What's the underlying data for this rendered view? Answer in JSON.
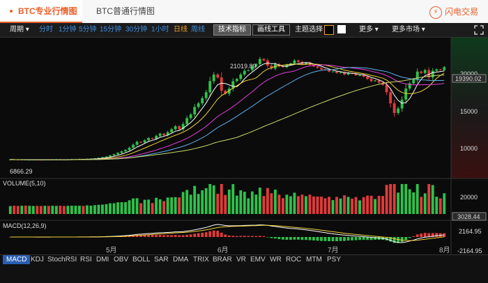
{
  "header": {
    "tab_active": "BTC专业行情图",
    "tab_normal": "BTC普通行情图",
    "brand": "闪电交易",
    "brand_icon": "lightning-icon"
  },
  "toolbar": {
    "period_menu": "周期",
    "periods": [
      "分时",
      "1分钟",
      "5分钟",
      "15分钟",
      "30分钟",
      "1小时",
      "日线",
      "周线"
    ],
    "selected_period": "日线",
    "tech_indicators": "技术指标",
    "draw_tools": "画线工具",
    "theme": "主题选择",
    "more": "更多",
    "more_markets": "更多市场"
  },
  "colors": {
    "up": "#2fc14b",
    "down": "#e23b3b",
    "ma1": "#ffffff",
    "ma2": "#f2d13a",
    "ma3": "#e83dde",
    "ma4": "#5fb0ee",
    "ma5": "#c5d968",
    "dif": "#ffffff",
    "dea": "#f2d13a"
  },
  "chart_data": {
    "type": "candlestick",
    "price_axis_ticks": [
      "20000",
      "15000",
      "10000"
    ],
    "price_ylim": [
      5000,
      21500
    ],
    "last_price": "19390.02",
    "max_label": "21019.89",
    "min_label": "6866.29",
    "months": [
      "5月",
      "6月",
      "7月",
      "8月"
    ],
    "volume_label": "VOLUME(5,10)",
    "volume_ticks": [
      "20000"
    ],
    "volume_last": "3028.44",
    "macd_label": "MACD(12,26,9)",
    "macd_ticks": [
      "2164.95",
      "-2164.95"
    ],
    "closes": [
      6900,
      6880,
      6870,
      6890,
      6860,
      6875,
      6880,
      6870,
      6865,
      6880,
      6870,
      6890,
      6900,
      6880,
      6875,
      6890,
      6910,
      6930,
      6950,
      6940,
      6980,
      7000,
      7050,
      7120,
      7200,
      7300,
      7450,
      7600,
      7800,
      8000,
      8200,
      8500,
      8900,
      9300,
      9200,
      9500,
      9800,
      9700,
      10100,
      10400,
      10200,
      10600,
      11000,
      11400,
      11000,
      11700,
      12500,
      13000,
      14000,
      14500,
      15200,
      16000,
      17500,
      18400,
      18000,
      16200,
      15800,
      16500,
      17500,
      17800,
      18400,
      18900,
      19000,
      19500,
      19800,
      20500,
      20300,
      19600,
      19200,
      19800,
      19500,
      19400,
      19700,
      19900,
      20300,
      20100,
      19800,
      20000,
      19700,
      19500,
      19300,
      19100,
      19000,
      18800,
      18800,
      18600,
      18700,
      18400,
      18600,
      18500,
      18300,
      18300,
      18100,
      17800,
      17500,
      17600,
      17300,
      17000,
      16000,
      14500,
      13200,
      13800,
      15000,
      16500,
      17200,
      17700,
      18800,
      18600,
      19000,
      18000,
      18900,
      19100,
      19000,
      19390
    ]
  },
  "indicators": [
    "MACD",
    "KDJ",
    "StochRSI",
    "RSI",
    "DMI",
    "OBV",
    "BOLL",
    "SAR",
    "DMA",
    "TRIX",
    "BRAR",
    "VR",
    "EMV",
    "WR",
    "ROC",
    "MTM",
    "PSY"
  ],
  "selected_indicator": "MACD"
}
